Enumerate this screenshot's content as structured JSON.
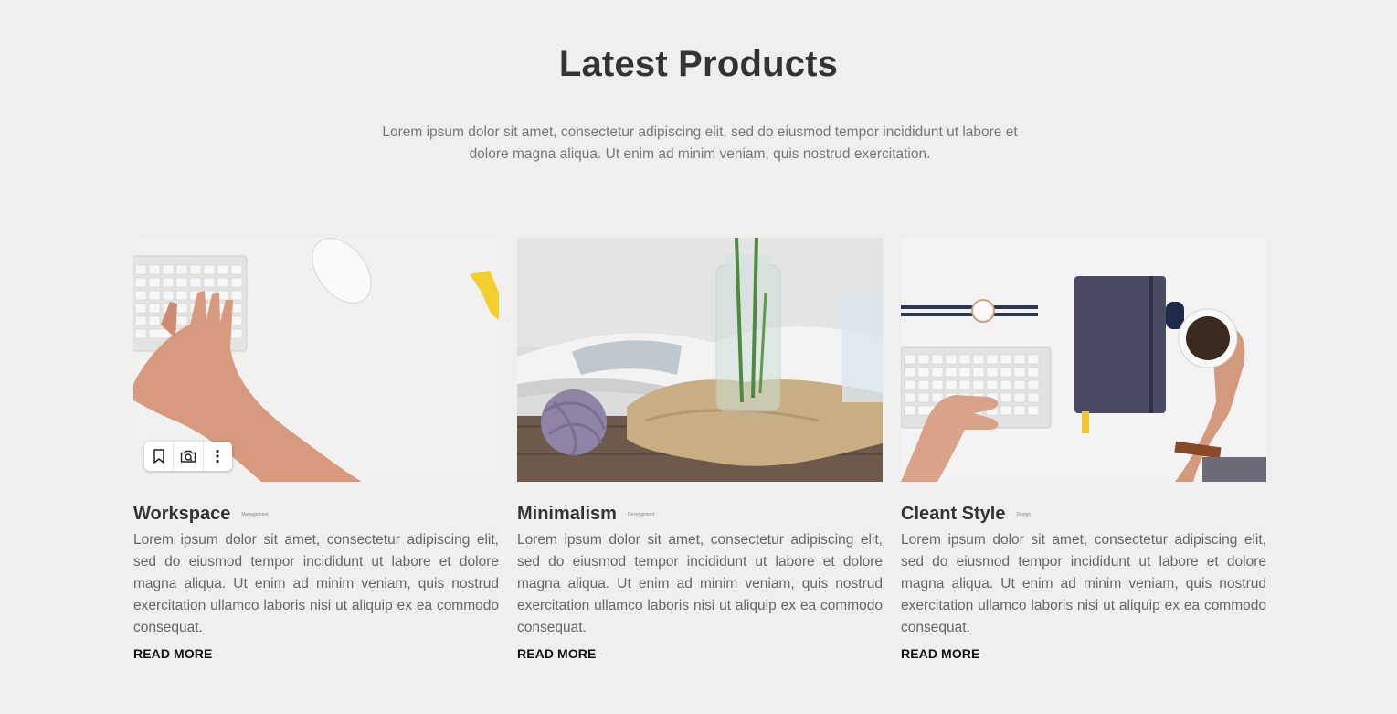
{
  "section": {
    "title": "Latest Products",
    "intro": "Lorem ipsum dolor sit amet, consectetur adipiscing elit, sed do eiusmod tempor incididunt ut labore et dolore magna aliqua. Ut enim ad minim veniam, quis nostrud exercitation."
  },
  "cards": [
    {
      "title": "Workspace",
      "tag": "Management",
      "text": "Lorem ipsum dolor sit amet, consectetur adipiscing elit, sed do eiusmod tempor incididunt ut labore et dolore magna aliqua. Ut enim ad minim veniam, quis nostrud exercitation ullamco laboris nisi ut aliquip ex ea commodo consequat.",
      "link": "READ MORE",
      "link_suffix": "-"
    },
    {
      "title": "Minimalism",
      "tag": "Development",
      "text": "Lorem ipsum dolor sit amet, consectetur adipiscing elit, sed do eiusmod tempor incididunt ut labore et dolore magna aliqua. Ut enim ad minim veniam, quis nostrud exercitation ullamco laboris nisi ut aliquip ex ea commodo consequat.",
      "link": "READ MORE",
      "link_suffix": "-"
    },
    {
      "title": "Cleant Style",
      "tag": "Design",
      "text": "Lorem ipsum dolor sit amet, consectetur adipiscing elit, sed do eiusmod tempor incididunt ut labore et dolore magna aliqua. Ut enim ad minim veniam, quis nostrud exercitation ullamco laboris nisi ut aliquip ex ea commodo consequat.",
      "link": "READ MORE",
      "link_suffix": "-"
    }
  ],
  "image_toolbar": {
    "icons": [
      "bookmark-icon",
      "camera-search-icon",
      "more-vertical-icon"
    ]
  },
  "colors": {
    "background": "#efefef",
    "heading": "#333333",
    "body_text": "#666666",
    "accent": "#3cc07a"
  }
}
